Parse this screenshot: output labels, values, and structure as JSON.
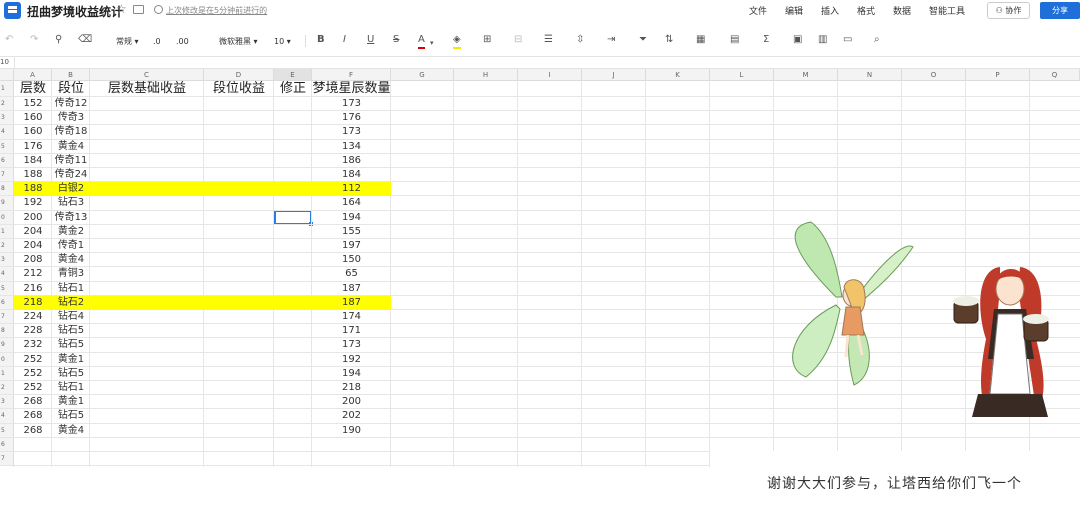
{
  "titlebar": {
    "title": "扭曲梦境收益统计",
    "save_status": "上次修改是在5分钟前进行的",
    "menu": [
      "文件",
      "编辑",
      "插入",
      "格式",
      "数据",
      "智能工具"
    ],
    "collab_label": "协作",
    "share_label": "分享"
  },
  "toolbar": {
    "format_label": "常规",
    "decimal_decrease": ".0",
    "decimal_increase": ".00",
    "font_name": "微软雅黑",
    "font_size": "10",
    "bold": "B",
    "italic": "I",
    "underline": "U",
    "strike": "S",
    "font_color": "A",
    "sum": "Σ"
  },
  "formula_bar": {
    "cell_ref": "10"
  },
  "columns": [
    "A",
    "B",
    "C",
    "D",
    "E",
    "F",
    "G",
    "H",
    "I",
    "J",
    "K",
    "L",
    "M",
    "N",
    "O",
    "P",
    "Q"
  ],
  "row_numbers": [
    "1",
    "2",
    "3",
    "4",
    "5",
    "6",
    "7",
    "8",
    "9",
    "0",
    "1",
    "2",
    "3",
    "4",
    "5",
    "6",
    "7",
    "8",
    "9",
    "0",
    "1",
    "2",
    "3",
    "4",
    "5",
    "6",
    "7"
  ],
  "table": {
    "headers": [
      "层数",
      "段位",
      "层数基础收益",
      "段位收益",
      "修正",
      "梦境星辰数量"
    ],
    "rows": [
      [
        "152",
        "传奇12",
        "173"
      ],
      [
        "160",
        "传奇3",
        "176"
      ],
      [
        "160",
        "传奇18",
        "173"
      ],
      [
        "176",
        "黄金4",
        "134"
      ],
      [
        "184",
        "传奇11",
        "186"
      ],
      [
        "188",
        "传奇24",
        "184"
      ],
      [
        "188",
        "白银2",
        "112"
      ],
      [
        "192",
        "钻石3",
        "164"
      ],
      [
        "200",
        "传奇13",
        "194"
      ],
      [
        "204",
        "黄金2",
        "155"
      ],
      [
        "204",
        "传奇1",
        "197"
      ],
      [
        "208",
        "黄金4",
        "150"
      ],
      [
        "212",
        "青铜3",
        "65"
      ],
      [
        "216",
        "钻石1",
        "187"
      ],
      [
        "218",
        "钻石2",
        "187"
      ],
      [
        "224",
        "钻石4",
        "174"
      ],
      [
        "228",
        "钻石5",
        "171"
      ],
      [
        "232",
        "钻石5",
        "173"
      ],
      [
        "252",
        "黄金1",
        "192"
      ],
      [
        "252",
        "钻石5",
        "194"
      ],
      [
        "252",
        "钻石1",
        "218"
      ],
      [
        "268",
        "黄金1",
        "200"
      ],
      [
        "268",
        "钻石5",
        "202"
      ],
      [
        "268",
        "黄金4",
        "190"
      ]
    ],
    "highlighted_rows": [
      6,
      14
    ],
    "highlight_color": "#ffff00"
  },
  "caption": "谢谢大大们参与，让塔西给你们飞一个",
  "colors": {
    "accent": "#1e6fd9",
    "selection": "#2a7de1"
  }
}
